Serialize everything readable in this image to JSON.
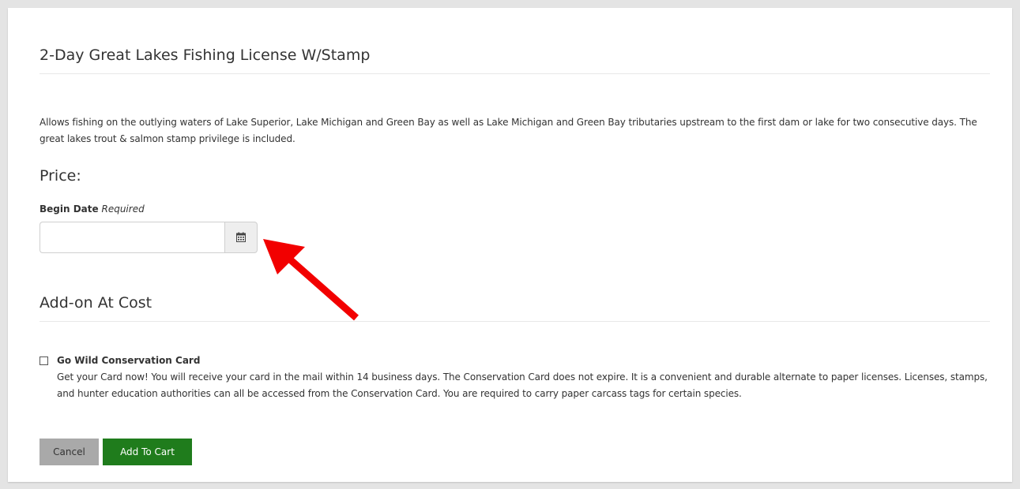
{
  "product": {
    "title": "2-Day Great Lakes Fishing License W/Stamp",
    "description": "Allows fishing on the outlying waters of Lake Superior, Lake Michigan and Green Bay as well as Lake Michigan and Green Bay tributaries upstream to the first dam or lake for two consecutive days. The great lakes trout & salmon stamp privilege is included.",
    "price_label": "Price:"
  },
  "begin_date": {
    "label": "Begin Date",
    "required_label": "Required",
    "value": "",
    "button_icon": "calendar-icon"
  },
  "annotation": {
    "arrow_color": "#f20000"
  },
  "addons": {
    "title": "Add-on At Cost",
    "items": [
      {
        "name": "Go Wild Conservation Card",
        "checked": false,
        "description": "Get your Card now! You will receive your card in the mail within 14 business days. The Conservation Card does not expire. It is a convenient and durable alternate to paper licenses. Licenses, stamps, and hunter education authorities can all be accessed from the Conservation Card. You are required to carry paper carcass tags for certain species."
      }
    ]
  },
  "actions": {
    "cancel_label": "Cancel",
    "add_label": "Add To Cart"
  },
  "colors": {
    "add_button": "#1f7c1c",
    "cancel_button": "#a9a9a9",
    "background": "#e4e4e4"
  }
}
